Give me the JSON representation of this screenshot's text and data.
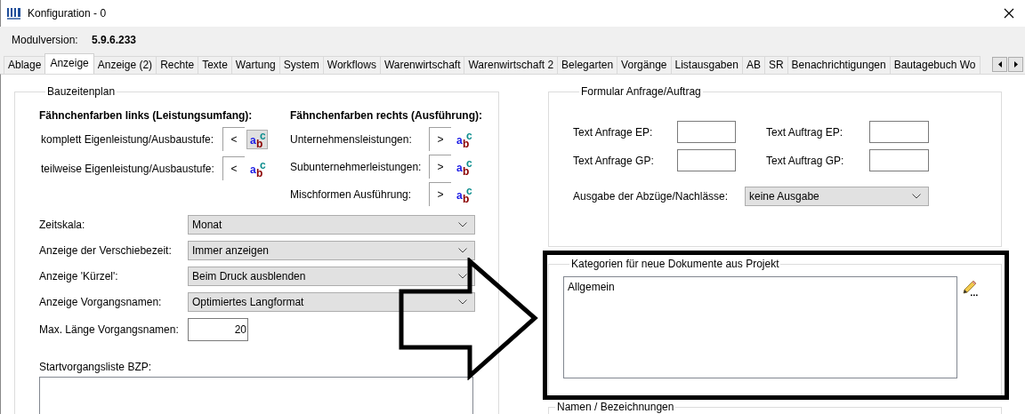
{
  "window": {
    "title": "Konfiguration - 0"
  },
  "module_version": {
    "label": "Modulversion:",
    "value": "5.9.6.233"
  },
  "tabs": [
    {
      "label": "Ablage",
      "selected": false
    },
    {
      "label": "Anzeige",
      "selected": true
    },
    {
      "label": "Anzeige (2)",
      "selected": false
    },
    {
      "label": "Rechte",
      "selected": false
    },
    {
      "label": "Texte",
      "selected": false
    },
    {
      "label": "Wartung",
      "selected": false
    },
    {
      "label": "System",
      "selected": false
    },
    {
      "label": "Workflows",
      "selected": false
    },
    {
      "label": "Warenwirtschaft",
      "selected": false
    },
    {
      "label": "Warenwirtschaft 2",
      "selected": false
    },
    {
      "label": "Belegarten",
      "selected": false
    },
    {
      "label": "Vorgänge",
      "selected": false
    },
    {
      "label": "Listausgaben",
      "selected": false
    },
    {
      "label": "AB",
      "selected": false
    },
    {
      "label": "SR",
      "selected": false
    },
    {
      "label": "Benachrichtigungen",
      "selected": false
    },
    {
      "label": "Bautagebuch Wo",
      "selected": false
    }
  ],
  "bauzeitenplan": {
    "title": "Bauzeitenplan",
    "left_heading": "Fähnchenfarben links (Leistungsumfang):",
    "left_rows": [
      {
        "label": "komplett Eigenleistung/Ausbaustufe:",
        "symbol": "<",
        "glyph": "abc",
        "pressed": true
      },
      {
        "label": "teilweise Eigenleistung/Ausbaustufe:",
        "symbol": "<",
        "glyph": "abc",
        "pressed": false
      }
    ],
    "right_heading": "Fähnchenfarben rechts (Ausführung):",
    "right_rows": [
      {
        "label": "Unternehmensleistungen:",
        "symbol": ">",
        "glyph": "abc",
        "pressed": false
      },
      {
        "label": "Subunternehmerleistungen:",
        "symbol": ">",
        "glyph": "abc",
        "pressed": false
      },
      {
        "label": "Mischformen Ausführung:",
        "symbol": ">",
        "glyph": "abc",
        "pressed": false
      }
    ],
    "settings": [
      {
        "kind": "dropdown",
        "label": "Zeitskala:",
        "value": "Monat"
      },
      {
        "kind": "dropdown",
        "label": "Anzeige der Verschiebezeit:",
        "value": "Immer anzeigen"
      },
      {
        "kind": "dropdown",
        "label": "Anzeige 'Kürzel':",
        "value": "Beim Druck ausblenden"
      },
      {
        "kind": "dropdown",
        "label": "Anzeige Vorgangsnamen:",
        "value": "Optimiertes Langformat"
      },
      {
        "kind": "number",
        "label": "Max. Länge Vorgangsnamen:",
        "value": "20"
      }
    ],
    "start_list": {
      "label": "Startvorgangsliste BZP:"
    }
  },
  "formular": {
    "title": "Formular Anfrage/Auftrag",
    "fields": [
      {
        "label": "Text Anfrage EP:"
      },
      {
        "label": "Text Auftrag EP:"
      },
      {
        "label": "Text Anfrage GP:"
      },
      {
        "label": "Text Auftrag GP:"
      }
    ],
    "deductions": {
      "label": "Ausgabe der Abzüge/Nachlässe:",
      "value": "keine Ausgabe"
    }
  },
  "kategorien": {
    "title": "Kategorien für neue Dokumente aus Projekt",
    "items": [
      "Allgemein"
    ]
  },
  "namen": {
    "title": "Namen / Bezeichnungen"
  }
}
